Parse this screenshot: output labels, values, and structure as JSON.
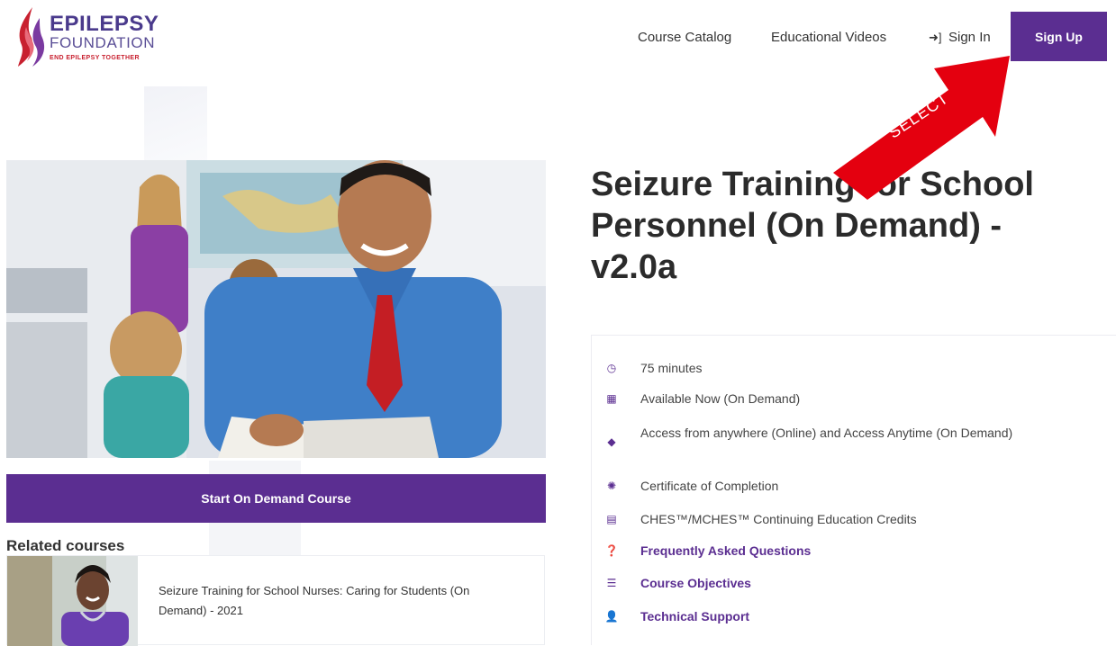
{
  "brand": {
    "name_line1": "EPILEPSY",
    "name_line2": "FOUNDATION",
    "tagline": "END EPILEPSY TOGETHER",
    "primary_color": "#5b2e91",
    "accent_color": "#c8202f"
  },
  "nav": {
    "course_catalog": "Course Catalog",
    "educational_videos": "Educational Videos",
    "sign_in": "Sign In",
    "sign_up": "Sign Up",
    "sign_in_icon": "sign-in-icon"
  },
  "annotation": {
    "label": "SELECT",
    "color": "#e4000f"
  },
  "course": {
    "title": "Seizure Training for School Personnel (On Demand) - v2.0a",
    "cta_label": "Start On Demand Course",
    "details": [
      {
        "icon": "clock-icon",
        "text": "75 minutes"
      },
      {
        "icon": "calendar-icon",
        "text": "Available Now (On Demand)"
      },
      {
        "icon": "location-icon",
        "text": "Access from anywhere (Online) and Access Anytime (On Demand)"
      },
      {
        "icon": "certificate-icon",
        "text": "Certificate of Completion"
      },
      {
        "icon": "credits-icon",
        "text": "CHES™/MCHES™ Continuing Education Credits"
      }
    ],
    "links": [
      {
        "icon": "question-icon",
        "text": "Frequently Asked Questions"
      },
      {
        "icon": "list-icon",
        "text": "Course Objectives"
      },
      {
        "icon": "user-support-icon",
        "text": "Technical Support"
      }
    ]
  },
  "related": {
    "heading": "Related courses",
    "items": [
      {
        "title": "Seizure Training for School Nurses: Caring for Students (On Demand) - 2021"
      }
    ]
  }
}
